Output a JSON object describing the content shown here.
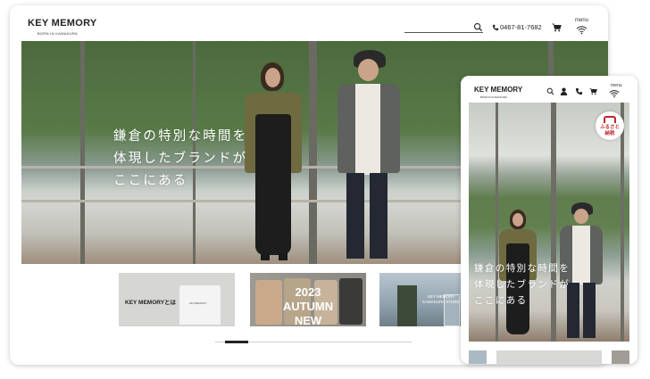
{
  "desktop": {
    "logo": "KEY MEMORY",
    "logo_sub": "BORN IN KAMAKURA",
    "phone": "0467-81-7682",
    "menu_label": "menu",
    "hero_text": [
      "鎌倉の特別な時間を",
      "体現したブランドが",
      "ここにある"
    ],
    "tiles": [
      {
        "label": "KEY MEMORYとは",
        "shirt_text": "KEYMEMORY"
      },
      {
        "label_line1": "2023 AUTUMN",
        "label_line2": "NEW ARRIVAL"
      },
      {
        "label_line1": "KEY MEMORY",
        "label_line2": "KAMAKURA STORE"
      }
    ]
  },
  "mobile": {
    "logo": "KEY MEMORY",
    "logo_sub": "BORN IN KAMAKURA",
    "menu_label": "menu",
    "hero_text": [
      "鎌倉の特別な時間を",
      "体現したブランドが",
      "ここにある"
    ],
    "badge_line1": "ふるさと",
    "badge_line2": "納税"
  },
  "icons": [
    "search-icon",
    "phone-icon",
    "cart-icon",
    "wifi-menu-icon",
    "user-icon"
  ],
  "colors": {
    "accent_red": "#c2262d",
    "text": "#222222"
  }
}
